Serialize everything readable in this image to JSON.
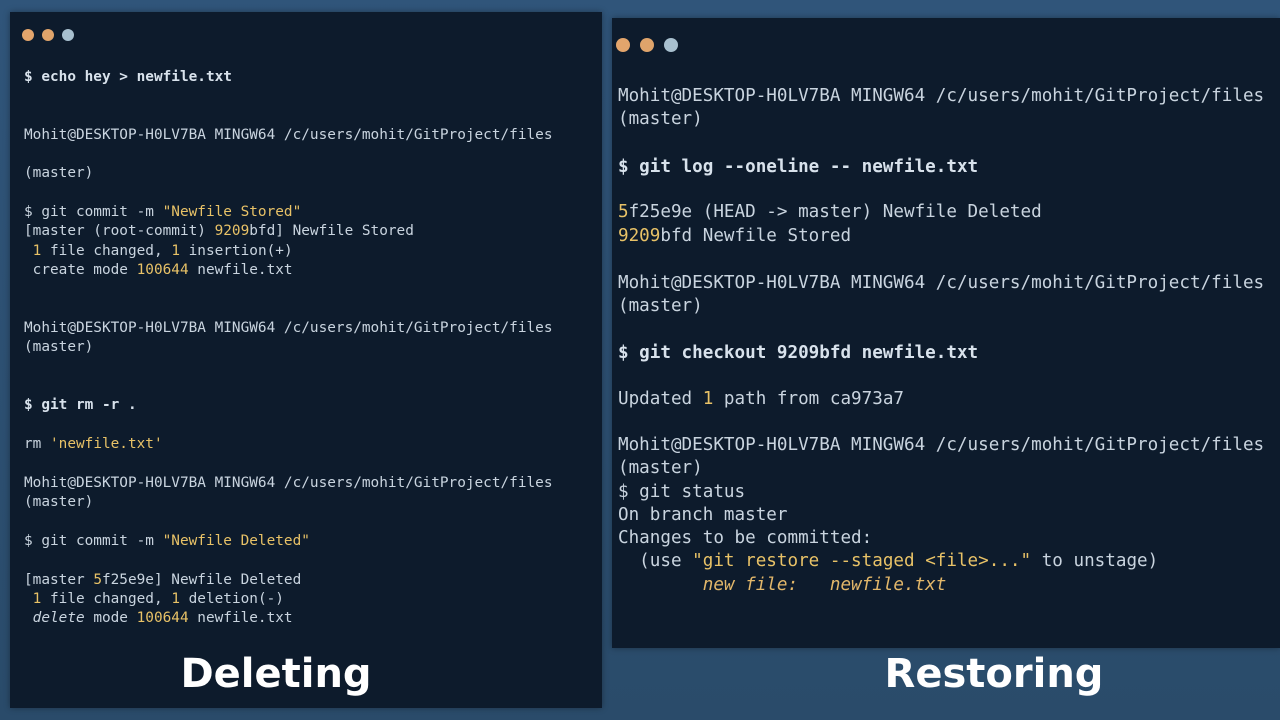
{
  "left_terminal": {
    "window_controls": [
      "dot-1",
      "dot-2",
      "dot-3"
    ],
    "lines": {
      "l1": "$ echo hey > newfile.txt",
      "l2": "Mohit@DESKTOP-H0LV7BA MINGW64 /c/users/mohit/GitProject/files",
      "l3": "(master)",
      "l4": "$ git commit -m ",
      "l4_str": "\"Newfile Stored\"",
      "l5a": "[master (root-commit) ",
      "l5_num": "9209",
      "l5b": "bfd] Newfile Stored",
      "l6a": " ",
      "l6_num1": "1",
      "l6b": " file changed, ",
      "l6_num2": "1",
      "l6c": " insertion(+)",
      "l7a": " create mode ",
      "l7_num": "100644",
      "l7b": " newfile.txt",
      "l8": "Mohit@DESKTOP-H0LV7BA MINGW64 /c/users/mohit/GitProject/files",
      "l9": "(master)",
      "l10": "$ git rm -r .",
      "l11a": "rm ",
      "l11_str": "'newfile.txt'",
      "l12": "Mohit@DESKTOP-H0LV7BA MINGW64 /c/users/mohit/GitProject/files",
      "l13": "(master)",
      "l14": "$ git commit -m ",
      "l14_str": "\"Newfile Deleted\"",
      "l15a": "[master ",
      "l15_num": "5",
      "l15b": "f25e9e] Newfile Deleted",
      "l16a": " ",
      "l16_num1": "1",
      "l16b": " file changed, ",
      "l16_num2": "1",
      "l16c": " deletion(-)",
      "l17_it": " delete",
      "l17b": " mode ",
      "l17_num": "100644",
      "l17c": " newfile.txt"
    }
  },
  "right_terminal": {
    "window_controls": [
      "dot-1",
      "dot-2",
      "dot-3"
    ],
    "lines": {
      "r1": "Mohit@DESKTOP-H0LV7BA MINGW64 /c/users/mohit/GitProject/files",
      "r2": "(master)",
      "r3": "$ git log --oneline -- newfile.txt",
      "r4a": "",
      "r4_num": "5",
      "r4b": "f25e9e (HEAD -> master) Newfile Deleted",
      "r5_num": "9209",
      "r5b": "bfd Newfile Stored",
      "r6": "Mohit@DESKTOP-H0LV7BA MINGW64 /c/users/mohit/GitProject/files",
      "r7": "(master)",
      "r8": "$ git checkout 9209bfd newfile.txt",
      "r9a": "Updated ",
      "r9_num": "1",
      "r9b": " path from ca973a7",
      "r10": "Mohit@DESKTOP-H0LV7BA MINGW64 /c/users/mohit/GitProject/files",
      "r11": "(master)",
      "r12": "$ git status",
      "r13": "On branch master",
      "r14": "Changes to be committed:",
      "r15a": "  (use ",
      "r15_str": "\"git restore --staged <file>...\"",
      "r15b": " to unstage)",
      "r16": "        new file:   newfile.txt"
    }
  },
  "captions": {
    "left": "Deleting",
    "right": "Restoring"
  }
}
